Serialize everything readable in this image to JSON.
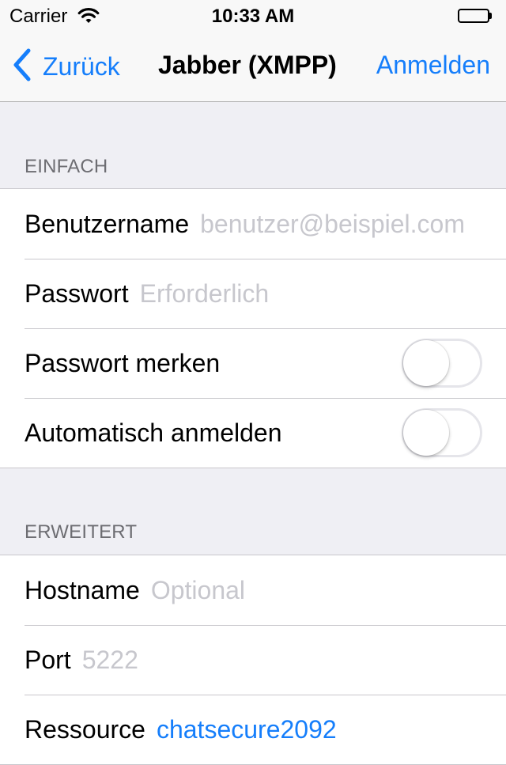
{
  "status_bar": {
    "carrier": "Carrier",
    "time": "10:33 AM",
    "wifi_icon": "wifi-icon",
    "battery_icon": "battery-icon"
  },
  "nav": {
    "back_label": "Zurück",
    "title": "Jabber (XMPP)",
    "login_label": "Anmelden",
    "accent_color": "#157efb"
  },
  "sections": {
    "basic": {
      "header": "EINFACH",
      "username_label": "Benutzername",
      "username_placeholder": "benutzer@beispiel.com",
      "username_value": "",
      "password_label": "Passwort",
      "password_placeholder": "Erforderlich",
      "password_value": "",
      "remember_label": "Passwort merken",
      "remember_on": false,
      "autologin_label": "Automatisch anmelden",
      "autologin_on": false
    },
    "advanced": {
      "header": "ERWEITERT",
      "hostname_label": "Hostname",
      "hostname_placeholder": "Optional",
      "hostname_value": "",
      "port_label": "Port",
      "port_placeholder": "5222",
      "port_value": "",
      "resource_label": "Ressource",
      "resource_value": "chatsecure2092"
    }
  }
}
